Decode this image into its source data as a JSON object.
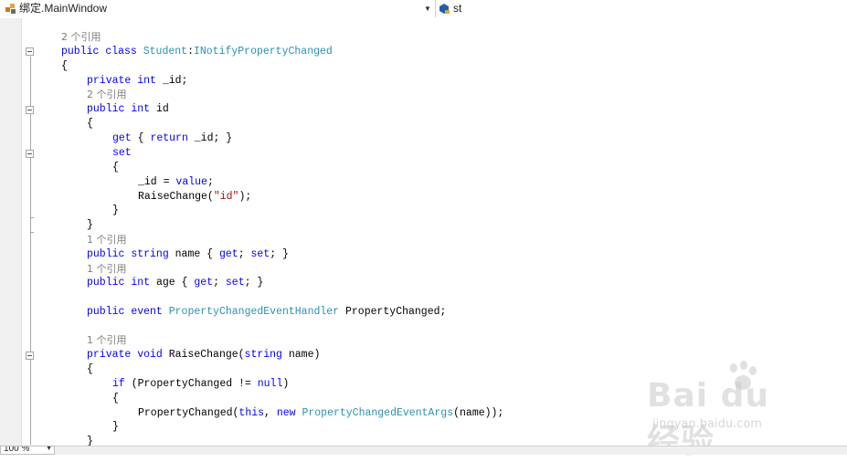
{
  "nav": {
    "type_selector": "绑定.MainWindow",
    "member_selector": "st",
    "type_icon": "class-icon",
    "member_icon": "field-icon"
  },
  "zoom": "100 %",
  "watermark": {
    "main": "Bai du 经验",
    "sub": "jingyan.baidu.com"
  },
  "code": {
    "ref_class": "2 个引用",
    "class_decl": {
      "kw1": "public",
      "kw2": "class",
      "name": "Student",
      "colon": ":",
      "iface": "INotifyPropertyChanged"
    },
    "open_class": "{",
    "field": {
      "kw1": "private",
      "kw2": "int",
      "rest": " _id;"
    },
    "ref_id": "2 个引用",
    "prop_id": {
      "kw1": "public",
      "kw2": "int",
      "rest": " id"
    },
    "open_prop": "{",
    "getter": {
      "kw1": "get",
      "mid": " { ",
      "kw2": "return",
      "rest": " _id; }"
    },
    "setter": "set",
    "open_set": "{",
    "assign": {
      "pre": "_id = ",
      "kw": "value",
      "post": ";"
    },
    "raise": {
      "pre": "RaiseChange(",
      "str": "\"id\"",
      "post": ");"
    },
    "close_set": "}",
    "close_prop": "}",
    "ref_name": "1 个引用",
    "prop_name": {
      "kw1": "public",
      "kw2": "string",
      "mid": " name { ",
      "g": "get",
      "sep": "; ",
      "s": "set",
      "end": "; }"
    },
    "ref_age": "1 个引用",
    "prop_age": {
      "kw1": "public",
      "kw2": "int",
      "mid": " age { ",
      "g": "get",
      "sep": "; ",
      "s": "set",
      "end": "; }"
    },
    "event_decl": {
      "kw1": "public",
      "kw2": "event",
      "type": "PropertyChangedEventHandler",
      "rest": " PropertyChanged;"
    },
    "ref_raise": "1 个引用",
    "method_decl": {
      "kw1": "private",
      "kw2": "void",
      "mid": " RaiseChange(",
      "kw3": "string",
      "rest": " name)"
    },
    "open_method": "{",
    "if_line": {
      "kw": "if",
      "mid": " (PropertyChanged != ",
      "kw2": "null",
      "end": ")"
    },
    "open_if": "{",
    "invoke": {
      "pre": "PropertyChanged(",
      "kw": "this",
      "mid": ", ",
      "kw2": "new",
      "sp": " ",
      "type": "PropertyChangedEventArgs",
      "end": "(name));"
    },
    "close_if": "}",
    "close_method": "}"
  }
}
